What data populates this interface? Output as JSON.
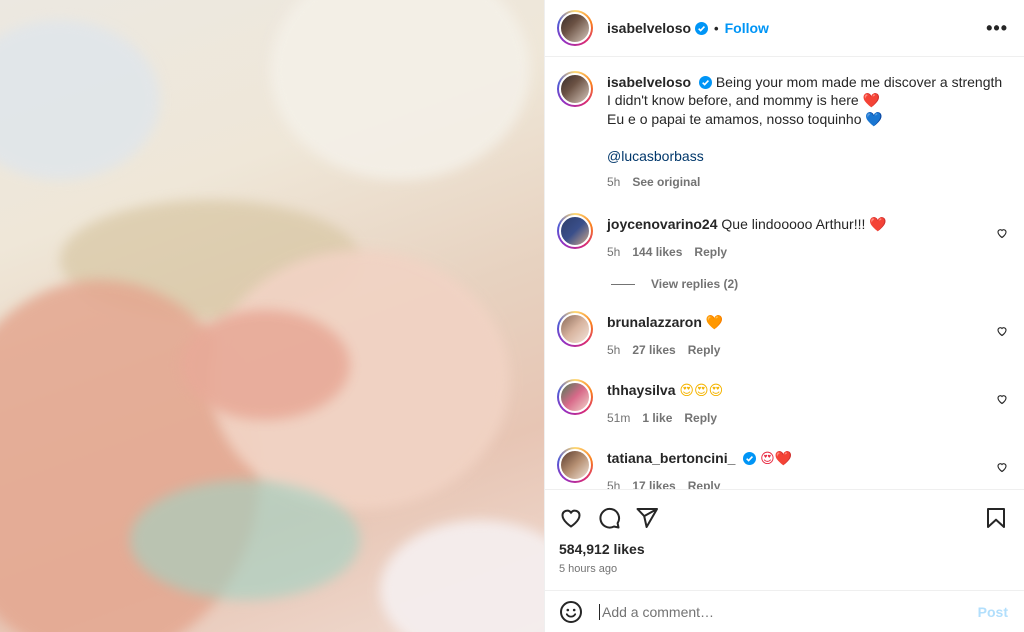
{
  "header": {
    "username": "isabelveloso",
    "separator": "•",
    "follow_label": "Follow",
    "more_label": "•••"
  },
  "caption": {
    "username": "isabelveloso",
    "text_line1": "Being your mom made me discover a strength I didn't know before, and mommy is here",
    "text_line1_emoji": "❤️",
    "text_line2": "Eu e o papai te amamos, nosso toquinho",
    "text_line2_emoji": "💙",
    "mention": "@lucasborbass",
    "time": "5h",
    "see_original": "See original"
  },
  "comments": [
    {
      "username": "joycenovarino24",
      "text": "Que lindooooo Arthur!!!",
      "emoji": "❤️",
      "time": "5h",
      "likes": "144 likes",
      "reply": "Reply",
      "verified": false
    },
    {
      "username": "brunalazzaron",
      "text": "",
      "emoji": "🧡",
      "time": "5h",
      "likes": "27 likes",
      "reply": "Reply",
      "verified": false
    },
    {
      "username": "thhaysilva",
      "text": "",
      "emoji": "😍😍😍",
      "time": "51m",
      "likes": "1 like",
      "reply": "Reply",
      "verified": false
    },
    {
      "username": "tatiana_bertoncini_",
      "text": "",
      "emoji": "😍❤️",
      "time": "5h",
      "likes": "17 likes",
      "reply": "Reply",
      "verified": true
    }
  ],
  "view_replies": "View replies (2)",
  "actions": {
    "likes": "584,912 likes",
    "time_ago": "5 hours ago"
  },
  "compose": {
    "placeholder": "Add a comment…",
    "post_label": "Post"
  },
  "colors": {
    "accent": "#0095f6",
    "link": "#00376b",
    "muted": "#737373"
  }
}
